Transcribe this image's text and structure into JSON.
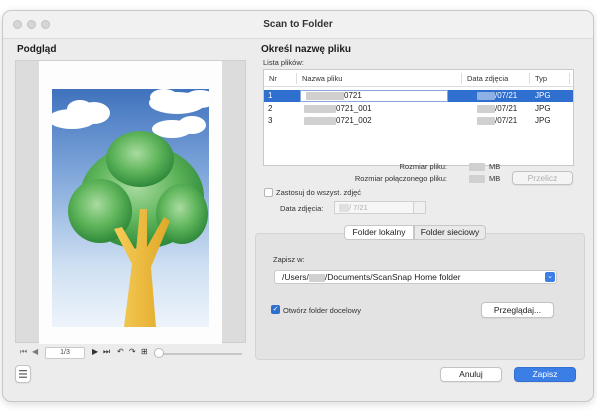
{
  "window": {
    "title": "Scan to Folder"
  },
  "preview": {
    "title": "Podgląd",
    "page_indicator": "1/3",
    "icons": [
      "first-page-icon",
      "prev-page-icon",
      "next-page-icon",
      "last-page-icon",
      "rotate-left-icon",
      "rotate-right-icon",
      "page-delete-icon"
    ]
  },
  "filename": {
    "title": "Określ nazwę pliku",
    "list_label": "Lista plików:",
    "columns": [
      "Nr",
      "Nazwa pliku",
      "Data zdjęcia",
      "Typ"
    ],
    "rows": [
      {
        "nr": "1",
        "name": "0721",
        "date": "/07/21",
        "type": "JPG",
        "selected": true
      },
      {
        "nr": "2",
        "name": "0721_001",
        "date": "/07/21",
        "type": "JPG",
        "selected": false
      },
      {
        "nr": "3",
        "name": "0721_002",
        "date": "/07/21",
        "type": "JPG",
        "selected": false
      }
    ],
    "file_size_label": "Rozmiar pliku:",
    "file_size_unit": "MB",
    "combined_size_label": "Rozmiar połączonego pliku:",
    "combined_size_unit": "MB",
    "recalc_label": "Przelicz",
    "apply_all_label": "Zastosuj do wszyst. zdjęć",
    "photo_date_label": "Data zdjęcia:",
    "photo_date_value": "/ 7/21"
  },
  "save": {
    "tabs": [
      "Folder lokalny",
      "Folder sieciowy"
    ],
    "save_in_label": "Zapisz w:",
    "path_prefix": "/Users/",
    "path_suffix": "/Documents/ScanSnap Home folder",
    "open_folder_label": "Otwórz folder docelowy",
    "browse_label": "Przeglądaj..."
  },
  "footer": {
    "cancel_label": "Anuluj",
    "save_label": "Zapisz"
  },
  "colors": {
    "accent": "#2f6fcf",
    "primary_button": "#3a7ee6",
    "tree_crown": "#4aa04a",
    "trunk": "#f0b93a",
    "sky": "#3f72bd"
  }
}
